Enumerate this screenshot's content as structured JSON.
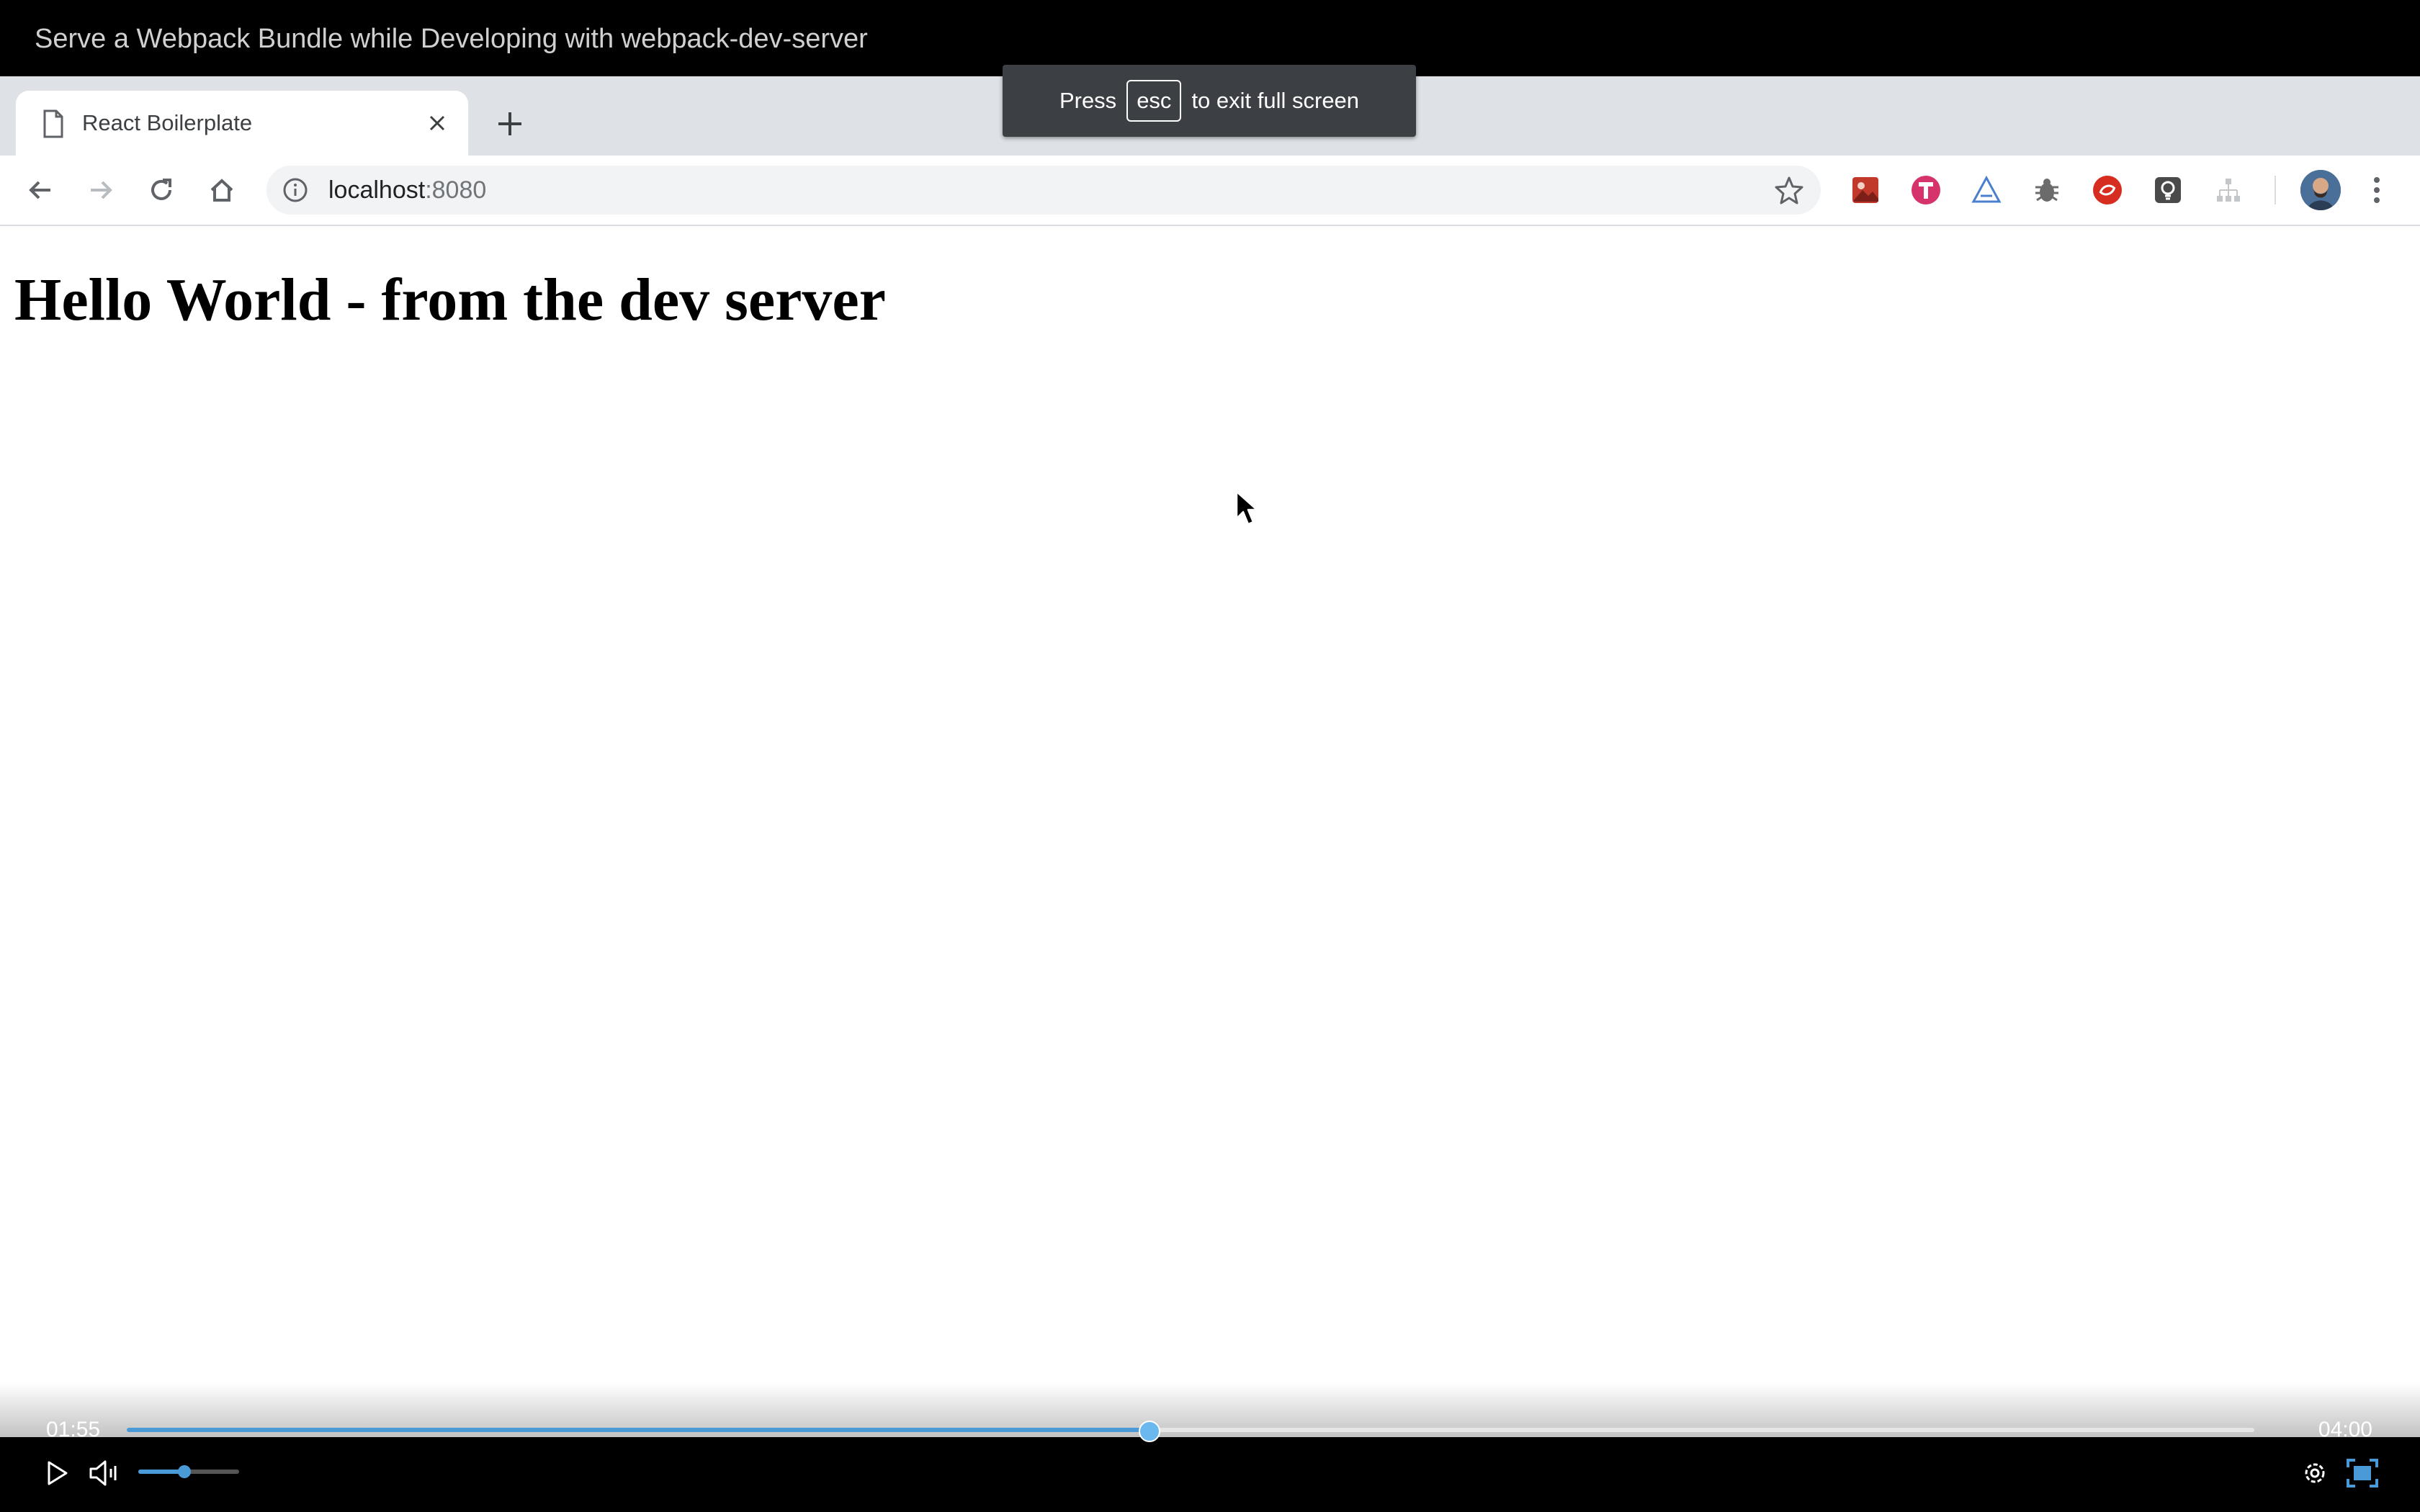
{
  "video": {
    "title": "Serve a Webpack Bundle while Developing with webpack-dev-server",
    "current_time": "01:55",
    "duration": "04:00",
    "progress": 0.48,
    "volume": 0.46,
    "accent_color": "#4a9ad8"
  },
  "browser": {
    "tab": {
      "title": "React Boilerplate",
      "icon": "page-icon"
    },
    "url": {
      "host": "localhost",
      "port": ":8080"
    },
    "extensions": [
      "image-extension-icon",
      "t-extension-icon",
      "triangle-extension-icon",
      "bug-extension-icon",
      "red-circle-extension-icon",
      "lightbulb-extension-icon",
      "sitemap-extension-icon"
    ]
  },
  "toast": {
    "prefix": "Press",
    "key": "esc",
    "suffix": "to exit full screen"
  },
  "page": {
    "heading": "Hello World - from the dev server"
  }
}
